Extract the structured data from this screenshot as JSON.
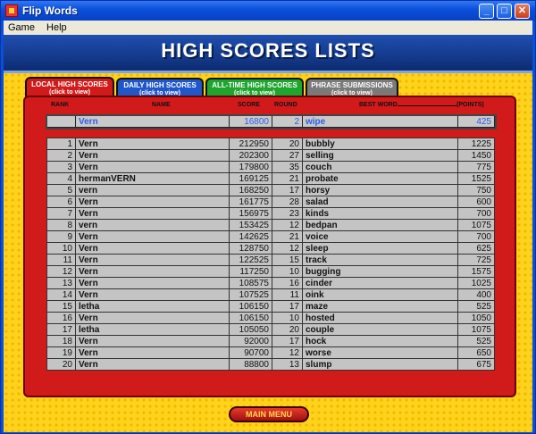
{
  "window": {
    "title": "Flip Words",
    "minimize": "_",
    "maximize": "□",
    "close": "✕"
  },
  "menu": {
    "game": "Game",
    "help": "Help"
  },
  "banner": {
    "title": "HIGH SCORES LISTS"
  },
  "tabs": [
    {
      "label": "LOCAL HIGH SCORES",
      "sub": "(click to view)"
    },
    {
      "label": "DAILY HIGH SCORES",
      "sub": "(click to view)"
    },
    {
      "label": "ALL-TIME HIGH SCORES",
      "sub": "(click to view)"
    },
    {
      "label": "PHRASE SUBMISSIONS",
      "sub": "(click to view)"
    }
  ],
  "columns": {
    "rank": "RANK",
    "name": "NAME",
    "score": "SCORE",
    "round": "ROUND",
    "best_word": "BEST WORD",
    "points": "(POINTS)"
  },
  "current": {
    "rank": "",
    "name": "Vern",
    "score": "16800",
    "round": "2",
    "word": "wipe",
    "points": "425"
  },
  "rows": [
    {
      "rank": "1",
      "name": "Vern",
      "score": "212950",
      "round": "20",
      "word": "bubbly",
      "points": "1225"
    },
    {
      "rank": "2",
      "name": "Vern",
      "score": "202300",
      "round": "27",
      "word": "selling",
      "points": "1450"
    },
    {
      "rank": "3",
      "name": "Vern",
      "score": "179800",
      "round": "35",
      "word": "couch",
      "points": "775"
    },
    {
      "rank": "4",
      "name": "hermanVERN",
      "score": "169125",
      "round": "21",
      "word": "probate",
      "points": "1525"
    },
    {
      "rank": "5",
      "name": "vern",
      "score": "168250",
      "round": "17",
      "word": "horsy",
      "points": "750"
    },
    {
      "rank": "6",
      "name": "Vern",
      "score": "161775",
      "round": "28",
      "word": "salad",
      "points": "600"
    },
    {
      "rank": "7",
      "name": "Vern",
      "score": "156975",
      "round": "23",
      "word": "kinds",
      "points": "700"
    },
    {
      "rank": "8",
      "name": "vern",
      "score": "153425",
      "round": "12",
      "word": "bedpan",
      "points": "1075"
    },
    {
      "rank": "9",
      "name": "Vern",
      "score": "142625",
      "round": "21",
      "word": "voice",
      "points": "700"
    },
    {
      "rank": "10",
      "name": "Vern",
      "score": "128750",
      "round": "12",
      "word": "sleep",
      "points": "625"
    },
    {
      "rank": "11",
      "name": "Vern",
      "score": "122525",
      "round": "15",
      "word": "track",
      "points": "725"
    },
    {
      "rank": "12",
      "name": "Vern",
      "score": "117250",
      "round": "10",
      "word": "bugging",
      "points": "1575"
    },
    {
      "rank": "13",
      "name": "Vern",
      "score": "108575",
      "round": "16",
      "word": "cinder",
      "points": "1025"
    },
    {
      "rank": "14",
      "name": "Vern",
      "score": "107525",
      "round": "11",
      "word": "oink",
      "points": "400"
    },
    {
      "rank": "15",
      "name": "letha",
      "score": "106150",
      "round": "17",
      "word": "maze",
      "points": "525"
    },
    {
      "rank": "16",
      "name": "Vern",
      "score": "106150",
      "round": "10",
      "word": "hosted",
      "points": "1050"
    },
    {
      "rank": "17",
      "name": "letha",
      "score": "105050",
      "round": "20",
      "word": "couple",
      "points": "1075"
    },
    {
      "rank": "18",
      "name": "Vern",
      "score": "92000",
      "round": "17",
      "word": "hock",
      "points": "525"
    },
    {
      "rank": "19",
      "name": "Vern",
      "score": "90700",
      "round": "12",
      "word": "worse",
      "points": "650"
    },
    {
      "rank": "20",
      "name": "Vern",
      "score": "88800",
      "round": "13",
      "word": "slump",
      "points": "675"
    }
  ],
  "main_menu": {
    "label": "MAIN MENU"
  },
  "colors": {
    "accent_red": "#d11a1a",
    "banner_blue": "#143a8c",
    "yellow": "#ffd21c",
    "tab_local": "#d11a1a",
    "tab_daily": "#1f57c9",
    "tab_alltime": "#1ea52e",
    "tab_phrase": "#7a7a7a",
    "current_text": "#2c5ee8"
  }
}
